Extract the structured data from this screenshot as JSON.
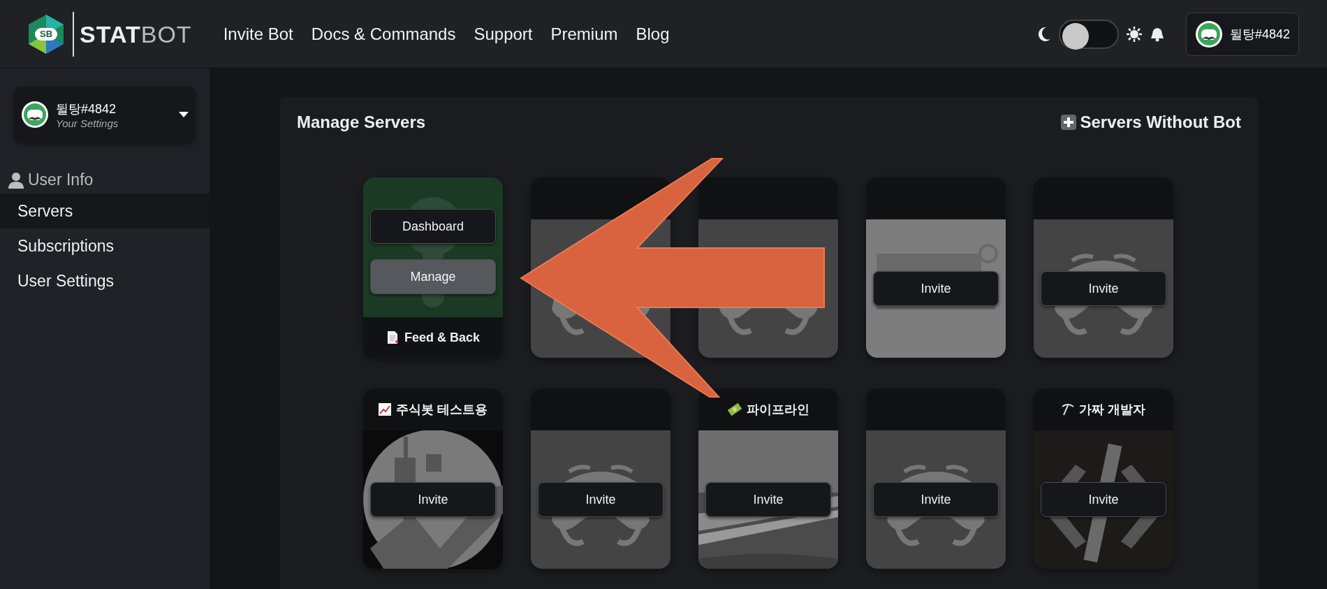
{
  "header": {
    "logo": {
      "badge": "SB",
      "bold": "STAT",
      "light": "BOT"
    },
    "nav": [
      "Invite Bot",
      "Docs & Commands",
      "Support",
      "Premium",
      "Blog"
    ],
    "theme_toggle": {
      "on": false
    },
    "user": {
      "name": "뒬탕#4842"
    }
  },
  "sidebar": {
    "profile": {
      "name": "뒬탕#4842",
      "subtitle": "Your Settings"
    },
    "section": "User Info",
    "items": [
      {
        "label": "Servers",
        "selected": true
      },
      {
        "label": "Subscriptions",
        "selected": false
      },
      {
        "label": "User Settings",
        "selected": false
      }
    ]
  },
  "main": {
    "title": "Manage Servers",
    "action": "Servers Without Bot",
    "servers": [
      {
        "kind": "managed",
        "name": "Feed & Back",
        "buttons": [
          "Dashboard",
          "Manage"
        ]
      },
      {
        "kind": "invite"
      },
      {
        "kind": "invite"
      },
      {
        "kind": "invite",
        "button": "Invite"
      },
      {
        "kind": "invite",
        "button": "Invite"
      },
      {
        "kind": "invite",
        "name": "주식봇 테스트용",
        "button": "Invite"
      },
      {
        "kind": "invite",
        "button": "Invite"
      },
      {
        "kind": "invite",
        "name": "파이프라인",
        "button": "Invite"
      },
      {
        "kind": "invite",
        "button": "Invite"
      },
      {
        "kind": "invite",
        "name": "가짜 개발자",
        "button": "Invite"
      }
    ]
  }
}
